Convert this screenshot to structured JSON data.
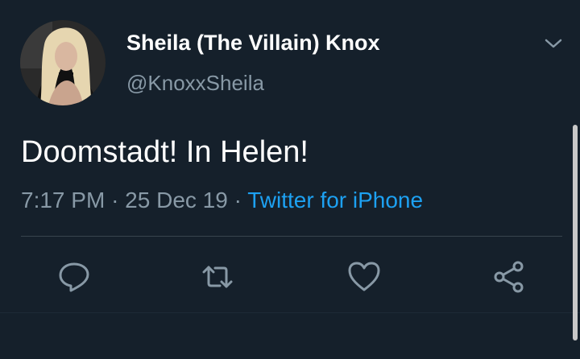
{
  "tweet": {
    "display_name": "Sheila (The Villain) Knox",
    "handle": "@KnoxxSheila",
    "text": "Doomstadt! In Helen!",
    "time": "7:17 PM",
    "separator": "·",
    "date": "25 Dec 19",
    "source": "Twitter for iPhone"
  },
  "icons": {
    "more": "chevron-down-icon",
    "reply": "reply-icon",
    "retweet": "retweet-icon",
    "like": "heart-icon",
    "share": "share-icon"
  },
  "colors": {
    "background": "#15202b",
    "secondary_text": "#8899a6",
    "link": "#1da1f2",
    "divider": "#38444d"
  }
}
